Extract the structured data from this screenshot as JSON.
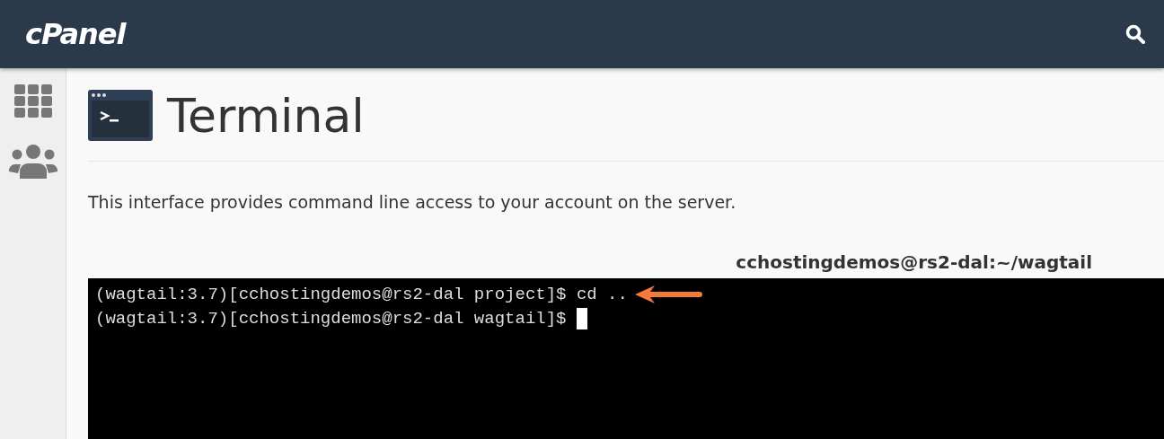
{
  "header": {
    "logo": "cPanel"
  },
  "page": {
    "title": "Terminal",
    "description": "This interface provides command line access to your account on the server."
  },
  "terminal": {
    "title": "cchostingdemos@rs2-dal:~/wagtail",
    "lines": [
      {
        "text": "(wagtail:3.7)[cchostingdemos@rs2-dal project]$ cd ..",
        "annotated": true,
        "cursor": false
      },
      {
        "text": "(wagtail:3.7)[cchostingdemos@rs2-dal wagtail]$ ",
        "annotated": false,
        "cursor": true
      }
    ]
  }
}
